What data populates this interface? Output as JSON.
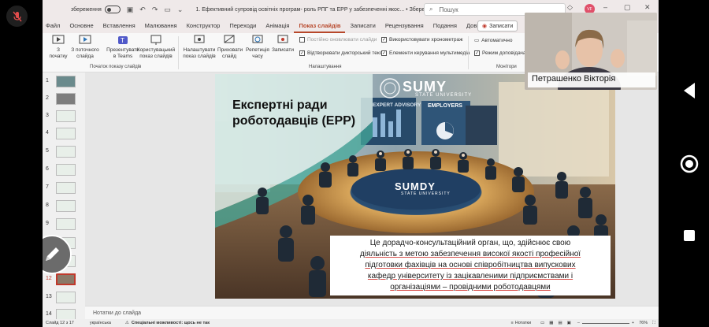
{
  "titlebar": {
    "toggle_label": "збереження",
    "doc_title": "1. Ефективний супровід освітніх програм- роль РПГ та ЕРР у забезпеченні якос... • Збережено у цей ПК",
    "search_placeholder": "Пошук",
    "user_initials": "VF"
  },
  "tabs": {
    "items": [
      "Файл",
      "Основне",
      "Вставлення",
      "Малювання",
      "Конструктор",
      "Переходи",
      "Анімація",
      "Показ слайдів",
      "Записати",
      "Рецензування",
      "Подання",
      "Довідка"
    ],
    "active": "Показ слайдів",
    "record_button": "Записати"
  },
  "ribbon": {
    "from_start": "З початку",
    "from_current": "З поточного слайда",
    "present_teams": "Презентувати в Teams",
    "custom_show": "Користувацький показ слайдів",
    "setup_show": "Налаштувати показ слайдів",
    "hide_slide": "Приховати слайд",
    "rehearse": "Репетиція часу",
    "record": "Записати",
    "chk_update": "Постійно оновлювати слайди",
    "chk_narration": "Відтворювати дикторський текст",
    "chk_timings": "Використовувати хронометраж",
    "chk_media": "Елементи керування мультимедіа",
    "monitor_auto": "Автоматично",
    "presenter_view": "Режим доповідача",
    "group_start": "Початок показу слайдів",
    "group_setup": "Налаштування",
    "group_monitors": "Монітори"
  },
  "thumbnails": [
    "1",
    "2",
    "3",
    "4",
    "5",
    "6",
    "7",
    "8",
    "9",
    "10",
    "11",
    "12",
    "13",
    "14"
  ],
  "current_slide": "12",
  "slide": {
    "title_line1": "Експертні ради",
    "title_line2": "роботодавців (ЕРР)",
    "logo_main": "SUMY",
    "logo_sub": "STATE UNIVERSITY",
    "sign_expert": "EXPERT ADVISORY",
    "sign_employers": "EMPLOYERS",
    "table_logo": "SUMDY",
    "table_logo_sub": "STATE UNIVERSITY",
    "caption_1": "Це дорадчо-консультаційний орган, що, здійснює свою",
    "caption_2": "діяльність з метою забезпечення високої якості професійної",
    "caption_3": "підготовки фахівців на основі співробітництва випускових",
    "caption_4": "кафедр університету із зацікавленими підприємствами і",
    "caption_5": "організаціями – провідними роботодавцями"
  },
  "notes_placeholder": "Нотатки до слайда",
  "status": {
    "slide_of": "Слайд 12 з 17",
    "language": "українська",
    "accessibility": "Спеціальні можливості: щось не так",
    "notes": "Нотатки",
    "zoom": "76%"
  },
  "video": {
    "participant_name": "Петрашенко Вікторія"
  },
  "colors": {
    "accent": "#b7472a",
    "current_thumb": "#c0392b",
    "caption_underline": "#d9534f"
  }
}
